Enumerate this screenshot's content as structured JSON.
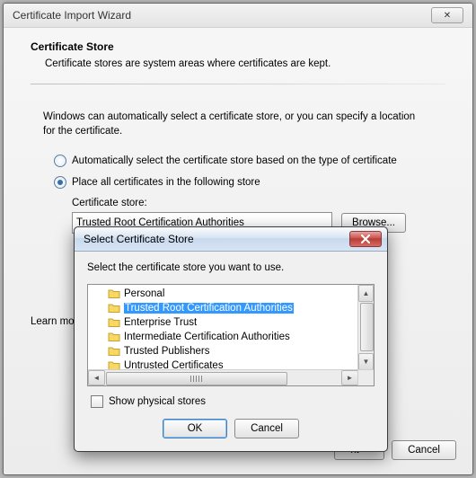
{
  "wizard": {
    "title": "Certificate Import Wizard",
    "section_title": "Certificate Store",
    "section_desc": "Certificate stores are system areas where certificates are kept.",
    "paragraph": "Windows can automatically select a certificate store, or you can specify a location for the certificate.",
    "radio_auto": "Automatically select the certificate store based on the type of certificate",
    "radio_place": "Place all certificates in the following store",
    "store_label": "Certificate store:",
    "store_value": "Trusted Root Certification Authorities",
    "browse": "Browse...",
    "learn": "Learn mor",
    "next": "xt >",
    "cancel": "Cancel"
  },
  "dialog": {
    "title": "Select Certificate Store",
    "desc": "Select the certificate store you want to use.",
    "items": [
      "Personal",
      "Trusted Root Certification Authorities",
      "Enterprise Trust",
      "Intermediate Certification Authorities",
      "Trusted Publishers",
      "Untrusted Certificates"
    ],
    "show_physical": "Show physical stores",
    "ok": "OK",
    "cancel": "Cancel"
  }
}
